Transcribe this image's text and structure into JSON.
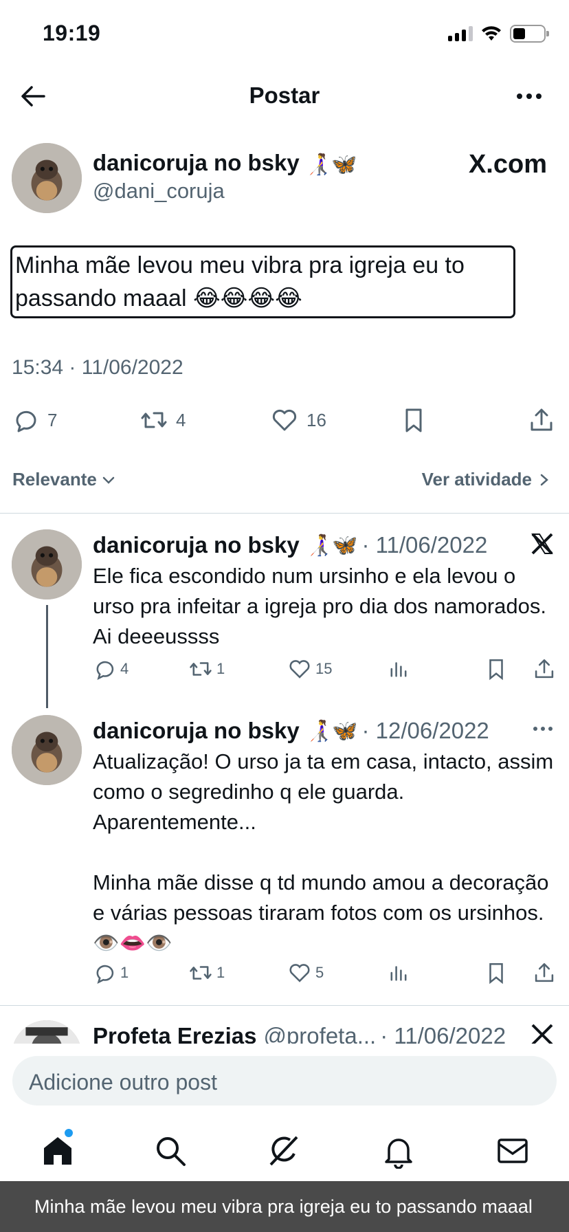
{
  "status_bar": {
    "time": "19:19"
  },
  "navbar": {
    "title": "Postar"
  },
  "main_post": {
    "author_name": "danicoruja no bsky",
    "author_emoji": "👩‍🦯🦋",
    "handle": "@dani_coruja",
    "badge": "X.com",
    "text": "Minha mãe levou meu vibra pra igreja eu to passando maaal 😂😂😂😂",
    "timestamp": "15:34 · 11/06/2022",
    "replies": "7",
    "reposts": "4",
    "likes": "16"
  },
  "sort": {
    "left_label": "Relevante",
    "right_label": "Ver atividade"
  },
  "replies": [
    {
      "author_name": "danicoruja no bsky",
      "author_emoji": "👩‍🦯🦋",
      "date": "· 11/06/2022",
      "text": "Ele fica escondido num ursinho e ela levou o urso pra infeitar a igreja pro dia dos namorados. Ai deeeussss",
      "replies": "4",
      "reposts": "1",
      "likes": "15"
    },
    {
      "author_name": "danicoruja no bsky",
      "author_emoji": "👩‍🦯🦋",
      "date": "· 12/06/2022",
      "text": "Atualização! O urso ja ta em casa, intacto, assim como o segredinho q ele guarda. Aparentemente...\n\nMinha mãe disse q td mundo amou a decoração e várias pessoas tiraram fotos com os ursinhos. 👁️👄👁️",
      "replies": "1",
      "reposts": "1",
      "likes": "5"
    },
    {
      "author_name": "Profeta Erezias",
      "handle": "@profeta...",
      "date": "· 11/06/2022"
    }
  ],
  "compose": {
    "placeholder": "Adicione outro post"
  },
  "tabbar": {
    "items": [
      "home-icon",
      "search-icon",
      "grok-icon",
      "bell-icon",
      "mail-icon"
    ]
  },
  "caption": {
    "text": "Minha mãe levou meu vibra pra igreja eu to passando maaal"
  },
  "colors": {
    "accent": "#1d9bf0",
    "text": "#0f1419",
    "muted": "#536471",
    "divider": "#cfd9de"
  }
}
